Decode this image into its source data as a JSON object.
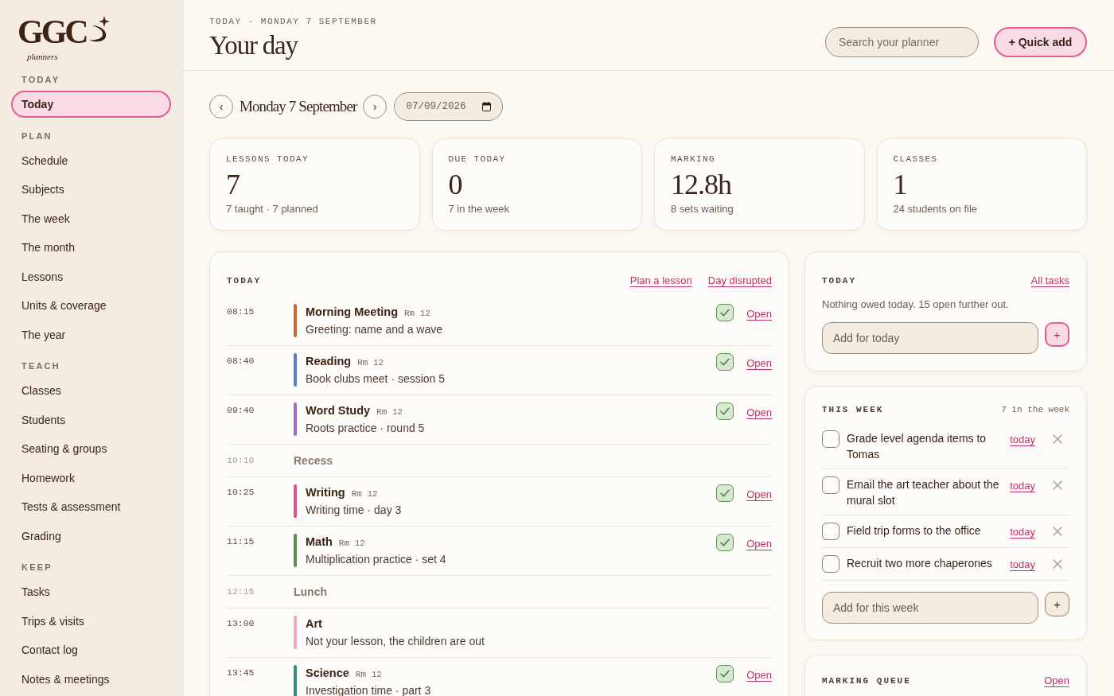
{
  "sidebar": {
    "logo": {
      "wordmark": "GGC",
      "tagline": "planners"
    },
    "sections": [
      {
        "heading": "TODAY",
        "items": [
          {
            "label": "Today",
            "selected": true
          }
        ]
      },
      {
        "heading": "PLAN",
        "items": [
          {
            "label": "Schedule",
            "selected": false
          },
          {
            "label": "Subjects",
            "selected": false
          },
          {
            "label": "The week",
            "selected": false
          },
          {
            "label": "The month",
            "selected": false
          },
          {
            "label": "Lessons",
            "selected": false
          },
          {
            "label": "Units & coverage",
            "selected": false
          },
          {
            "label": "The year",
            "selected": false
          }
        ]
      },
      {
        "heading": "TEACH",
        "items": [
          {
            "label": "Classes",
            "selected": false
          },
          {
            "label": "Students",
            "selected": false
          },
          {
            "label": "Seating & groups",
            "selected": false
          },
          {
            "label": "Homework",
            "selected": false
          },
          {
            "label": "Tests & assessment",
            "selected": false
          },
          {
            "label": "Grading",
            "selected": false
          }
        ]
      },
      {
        "heading": "KEEP",
        "items": [
          {
            "label": "Tasks",
            "selected": false
          },
          {
            "label": "Trips & visits",
            "selected": false
          },
          {
            "label": "Contact log",
            "selected": false
          },
          {
            "label": "Notes & meetings",
            "selected": false
          }
        ]
      }
    ]
  },
  "header": {
    "eyebrow": "TODAY · MONDAY 7 SEPTEMBER",
    "title": "Your day",
    "search": {
      "placeholder": "Search your planner"
    },
    "quick_add": "+ Quick add"
  },
  "date_nav": {
    "previous": "‹",
    "label": "Monday 7 September",
    "next": "›",
    "date": "07/09/2026"
  },
  "stats": [
    {
      "label": "LESSONS TODAY",
      "value": "7",
      "note": "7 taught · 7 planned"
    },
    {
      "label": "DUE TODAY",
      "value": "0",
      "note": "7 in the week"
    },
    {
      "label": "MARKING",
      "value": "12.8h",
      "note": "8 sets waiting"
    },
    {
      "label": "CLASSES",
      "value": "1",
      "note": "24 students on file"
    }
  ],
  "schedule": {
    "heading": "TODAY",
    "links": [
      "Plan a lesson",
      "Day disrupted"
    ],
    "rows": [
      {
        "kind": "lesson",
        "time": "08:15",
        "title": "Morning Meeting",
        "room": "Rm 12",
        "detail": "Greeting: name and a wave",
        "color": "#c96a2b",
        "done": true,
        "action": "Open"
      },
      {
        "kind": "lesson",
        "time": "08:40",
        "title": "Reading",
        "room": "Rm 12",
        "detail": "Book clubs meet · session 5",
        "color": "#5b7ec9",
        "done": true,
        "action": "Open"
      },
      {
        "kind": "lesson",
        "time": "09:40",
        "title": "Word Study",
        "room": "Rm 12",
        "detail": "Roots practice · round 5",
        "color": "#a06bc8",
        "done": true,
        "action": "Open"
      },
      {
        "kind": "break",
        "time": "10:10",
        "title": "Recess"
      },
      {
        "kind": "lesson",
        "time": "10:25",
        "title": "Writing",
        "room": "Rm 12",
        "detail": "Writing time · day 3",
        "color": "#e3508c",
        "done": true,
        "action": "Open"
      },
      {
        "kind": "lesson",
        "time": "11:15",
        "title": "Math",
        "room": "Rm 12",
        "detail": "Multiplication practice · set 4",
        "color": "#5b8f4b",
        "done": true,
        "action": "Open"
      },
      {
        "kind": "break",
        "time": "12:15",
        "title": "Lunch"
      },
      {
        "kind": "cover",
        "time": "13:00",
        "title": "Art",
        "detail": "Not your lesson, the children are out",
        "color": "#efa7c5"
      },
      {
        "kind": "lesson",
        "time": "13:45",
        "title": "Science",
        "room": "Rm 12",
        "detail": "Investigation time · part 3",
        "color": "#3d8c7c",
        "done": true,
        "action": "Open"
      }
    ]
  },
  "today_tasks": {
    "heading": "TODAY",
    "link": "All tasks",
    "message": "Nothing owed today. 15 open further out.",
    "add": {
      "placeholder": "Add for today",
      "button": "+"
    }
  },
  "week_tasks": {
    "heading": "THIS WEEK",
    "count": "7 in the week",
    "tasks": [
      {
        "text": "Grade level agenda items to Tomas",
        "checked": false,
        "action": "today"
      },
      {
        "text": "Email the art teacher about the mural slot",
        "checked": false,
        "action": "today"
      },
      {
        "text": "Field trip forms to the office",
        "checked": false,
        "action": "today"
      },
      {
        "text": "Recruit two more chaperones",
        "checked": false,
        "action": "today"
      }
    ],
    "add": {
      "placeholder": "Add for this week",
      "button": "+"
    }
  },
  "marking_queue": {
    "heading": "MARKING QUEUE",
    "link": "Open"
  }
}
